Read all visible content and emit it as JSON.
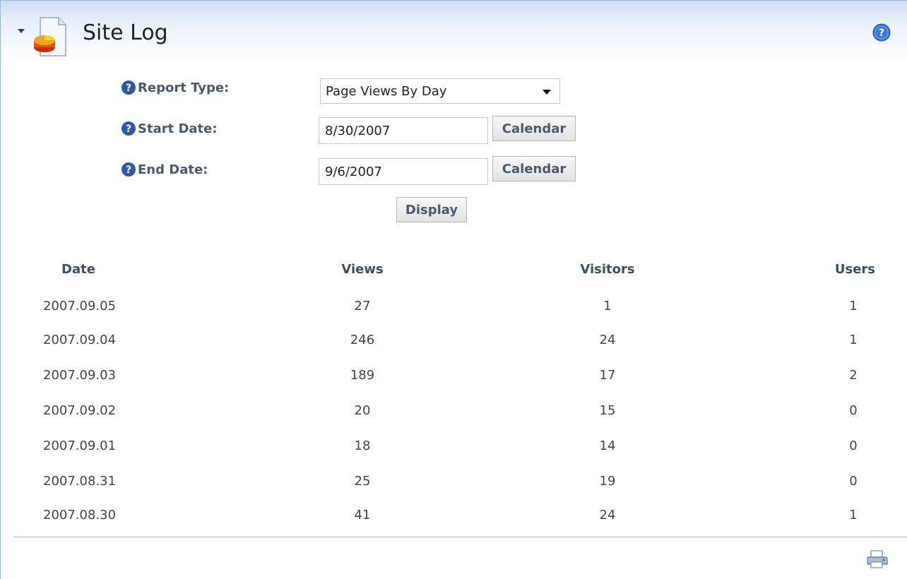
{
  "module": {
    "title": "Site Log",
    "icons": {
      "collapse": "collapse-arrow-icon",
      "module": "site-log-chart-icon",
      "help": "help-icon",
      "print": "print-icon"
    }
  },
  "form": {
    "report_type": {
      "label": "Report Type:",
      "value": "Page Views By Day"
    },
    "start_date": {
      "label": "Start Date:",
      "value": "8/30/2007",
      "button": "Calendar"
    },
    "end_date": {
      "label": "End Date:",
      "value": "9/6/2007",
      "button": "Calendar"
    },
    "display_button": "Display"
  },
  "table": {
    "headers": [
      "Date",
      "Views",
      "Visitors",
      "Users"
    ],
    "rows": [
      [
        "2007.09.05",
        "27",
        "1",
        "1"
      ],
      [
        "2007.09.04",
        "246",
        "24",
        "1"
      ],
      [
        "2007.09.03",
        "189",
        "17",
        "2"
      ],
      [
        "2007.09.02",
        "20",
        "15",
        "0"
      ],
      [
        "2007.09.01",
        "18",
        "14",
        "0"
      ],
      [
        "2007.08.31",
        "25",
        "19",
        "0"
      ],
      [
        "2007.08.30",
        "41",
        "24",
        "1"
      ]
    ]
  },
  "colors": {
    "header_gradient_top": "#cfdcf2",
    "label": "#4a5a6e",
    "border": "#9db3d6"
  }
}
